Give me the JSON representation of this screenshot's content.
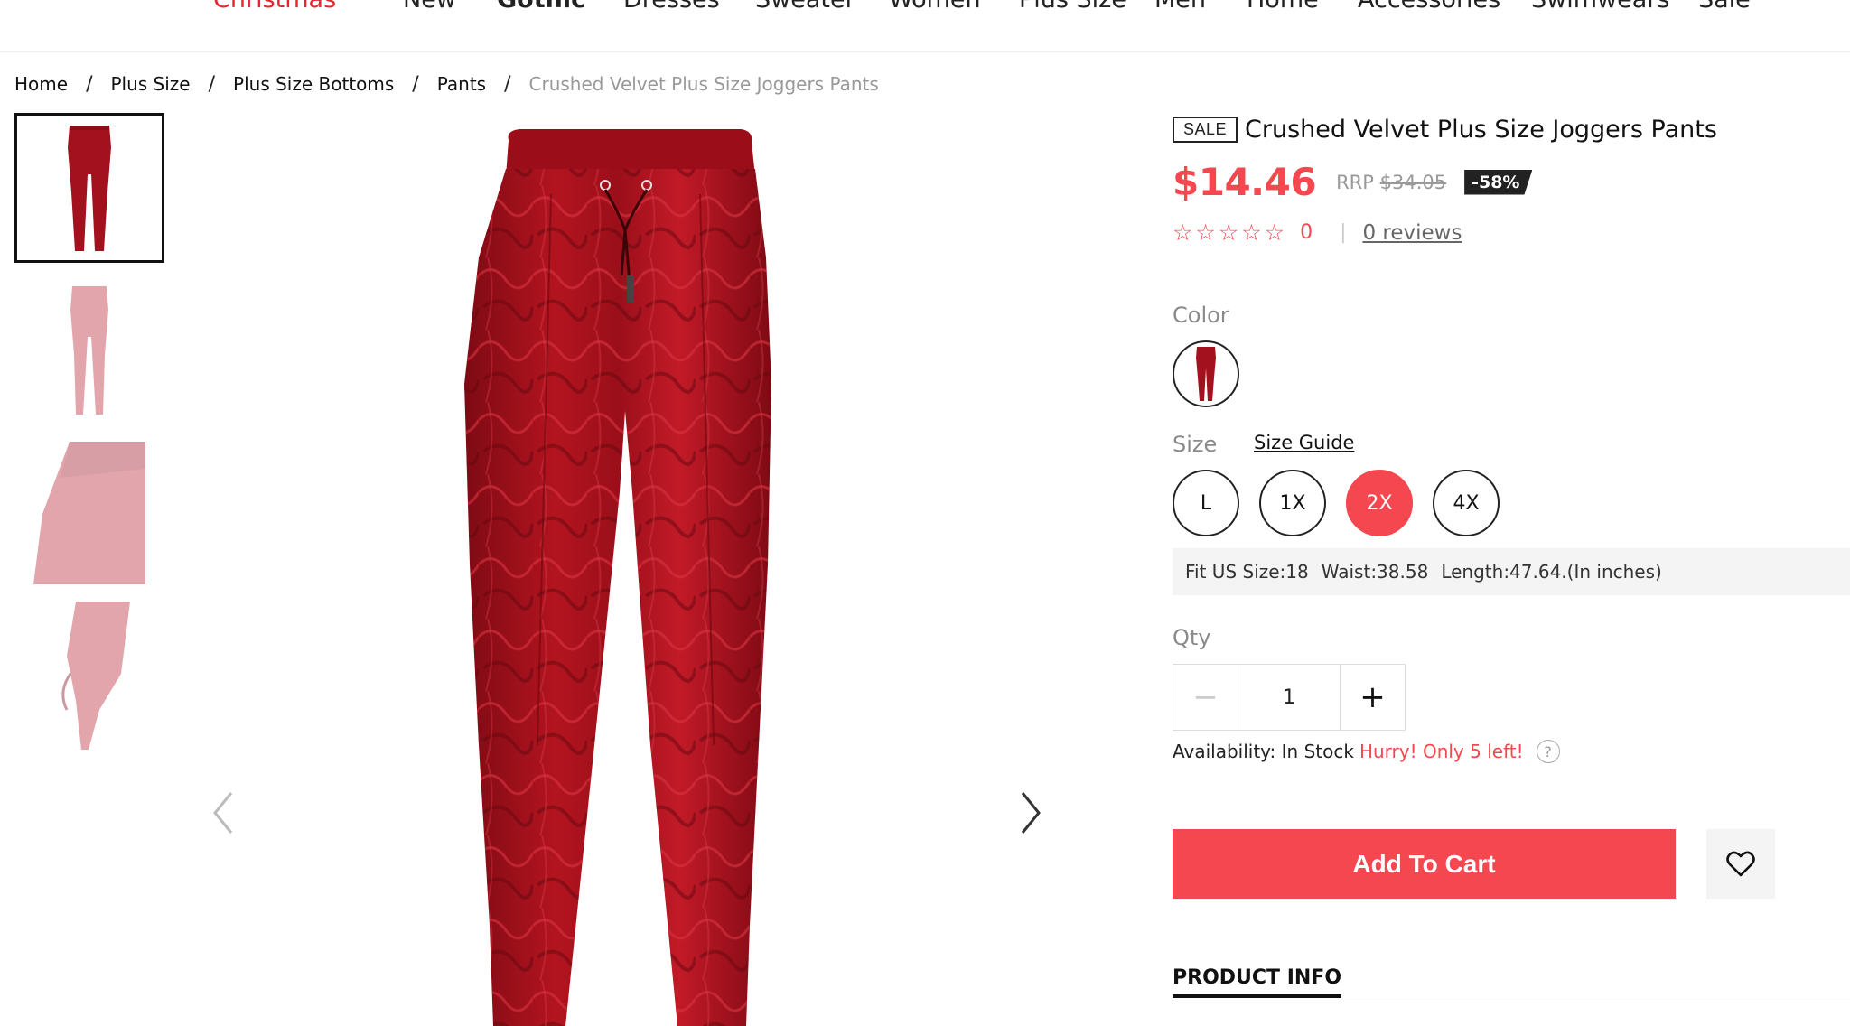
{
  "nav": {
    "items": [
      {
        "label": "Christmas",
        "highlight": true
      },
      {
        "label": "New"
      },
      {
        "label": "Gothic"
      },
      {
        "label": "Dresses"
      },
      {
        "label": "Sweater"
      },
      {
        "label": "Women"
      },
      {
        "label": "Plus Size"
      },
      {
        "label": "Men"
      },
      {
        "label": "Home"
      },
      {
        "label": "Accessories"
      },
      {
        "label": "Swimwears"
      },
      {
        "label": "Sale"
      }
    ]
  },
  "breadcrumb": {
    "items": [
      "Home",
      "Plus Size",
      "Plus Size Bottoms",
      "Pants",
      "Crushed Velvet Plus Size Joggers Pants"
    ],
    "separator": "/"
  },
  "product": {
    "sale_tag": "SALE",
    "title": "Crushed Velvet Plus Size Joggers Pants",
    "price": "$14.46",
    "rrp_label": "RRP",
    "rrp_value": "$34.05",
    "discount": "-58%",
    "rating_count": "0",
    "reviews_link": "0 reviews",
    "color_label": "Color",
    "size_label": "Size",
    "size_guide": "Size Guide",
    "sizes": [
      "L",
      "1X",
      "2X",
      "4X"
    ],
    "selected_size": "2X",
    "fit": [
      "Fit US Size:18",
      "Waist:38.58",
      "Length:47.64.(In inches)"
    ],
    "qty_label": "Qty",
    "qty_value": "1",
    "availability_label": "Availability: In Stock",
    "availability_note": "Hurry! Only 5 left!",
    "add_to_cart": "Add To Cart",
    "tab_product_info": "PRODUCT INFO"
  },
  "colors": {
    "accent": "#f4474f",
    "velvet": "#a3111e",
    "dark": "#222222"
  },
  "icons": [
    "star-outline-icon",
    "help-icon",
    "heart-icon",
    "chevron-left-icon",
    "chevron-right-icon",
    "minus-icon",
    "plus-icon"
  ]
}
